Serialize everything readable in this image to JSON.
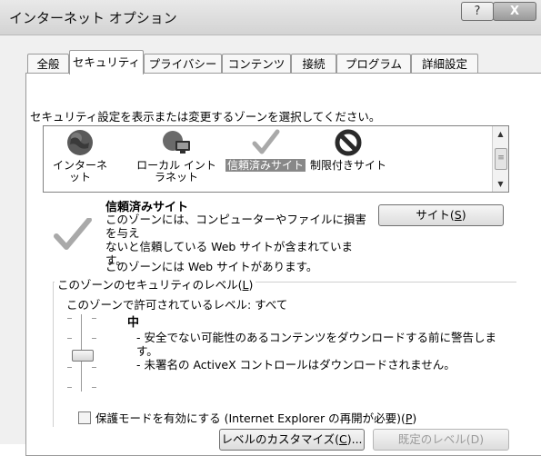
{
  "window": {
    "title": "インターネット オプション",
    "help_label": "?",
    "close_label": "X"
  },
  "tabs": [
    {
      "label": "全般"
    },
    {
      "label": "セキュリティ"
    },
    {
      "label": "プライバシー"
    },
    {
      "label": "コンテンツ"
    },
    {
      "label": "接続"
    },
    {
      "label": "プログラム"
    },
    {
      "label": "詳細設定"
    }
  ],
  "zones": {
    "caption": "セキュリティ設定を表示または変更するゾーンを選択してください。",
    "items": [
      {
        "label": "インターネット",
        "icon": "globe-icon"
      },
      {
        "label": "ローカル イントラネット",
        "icon": "intranet-icon"
      },
      {
        "label": "信頼済みサイト",
        "icon": "checkmark-icon",
        "selected": true
      },
      {
        "label": "制限付きサイト",
        "icon": "restricted-icon"
      }
    ],
    "label_lines": {
      "internet": "インターネット",
      "intranet_1": "ローカル イント",
      "intranet_2": "ラネット",
      "trusted": "信頼済みサイト",
      "restricted": "制限付きサイト"
    }
  },
  "selected_zone": {
    "title": "信頼済みサイト",
    "desc_line1": "このゾーンには、コンピューターやファイルに損害を与え",
    "desc_line2": "ないと信頼している Web サイトが含まれています。",
    "note": "このゾーンには Web サイトがあります。",
    "sites_button_prefix": "サイト(",
    "sites_button_key": "S",
    "sites_button_suffix": ")"
  },
  "security_level": {
    "group_label_prefix": "このゾーンのセキュリティのレベル(",
    "group_label_key": "L",
    "group_label_suffix": ")",
    "allowed": "このゾーンで許可されているレベル: すべて",
    "level_name": "中",
    "line1": "- 安全でない可能性のあるコンテンツをダウンロードする前に警告しま",
    "line2": "す。",
    "line3": "- 未署名の ActiveX コントロールはダウンロードされません。"
  },
  "protected_mode": {
    "label_prefix": "保護モードを有効にする (Internet Explorer の再開が必要)(",
    "label_key": "P",
    "label_suffix": ")",
    "checked": false
  },
  "buttons": {
    "custom_prefix": "レベルのカスタマイズ(",
    "custom_key": "C",
    "custom_suffix": ")...",
    "default_label": "既定のレベル(D)"
  }
}
